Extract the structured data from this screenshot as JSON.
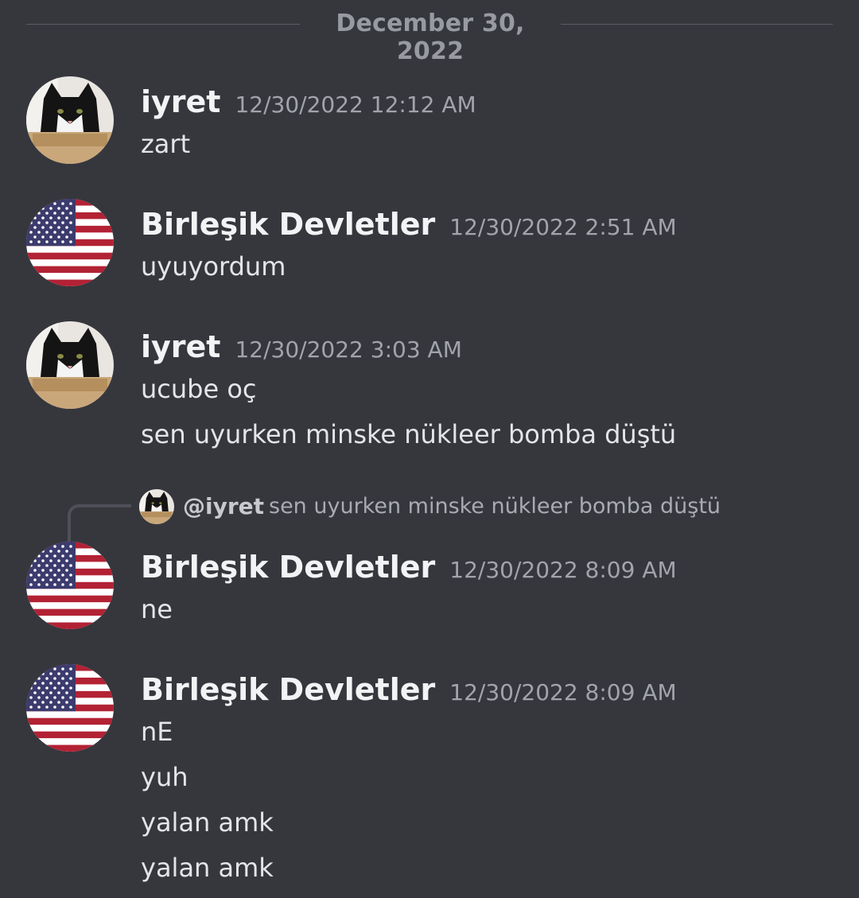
{
  "divider": {
    "date": "December 30, 2022"
  },
  "messages": [
    {
      "author": "iyret",
      "timestamp": "12/30/2022 12:12 AM",
      "avatar": "cat-avatar",
      "lines": [
        "zart"
      ]
    },
    {
      "author": "Birleşik Devletler",
      "timestamp": "12/30/2022 2:51 AM",
      "avatar": "us-flag-avatar",
      "lines": [
        "uyuyordum"
      ]
    },
    {
      "author": "iyret",
      "timestamp": "12/30/2022 3:03 AM",
      "avatar": "cat-avatar",
      "lines": [
        "ucube oç",
        "sen uyurken minske nükleer bomba düştü"
      ]
    },
    {
      "author": "Birleşik Devletler",
      "timestamp": "12/30/2022 8:09 AM",
      "avatar": "us-flag-avatar",
      "lines": [
        "ne"
      ]
    },
    {
      "author": "Birleşik Devletler",
      "timestamp": "12/30/2022 8:09 AM",
      "avatar": "us-flag-avatar",
      "lines": [
        "nE",
        "yuh",
        "yalan amk",
        "yalan amk"
      ]
    }
  ],
  "reply": {
    "mention": "@iyret",
    "text": "sen uyurken minske nükleer bomba düştü",
    "avatar": "cat-avatar"
  },
  "colors": {
    "background": "#36373d",
    "username": "#f2f3f5",
    "timestamp": "#a2a4ab",
    "message": "#e3e5e8",
    "divider": "#5c5e66"
  }
}
